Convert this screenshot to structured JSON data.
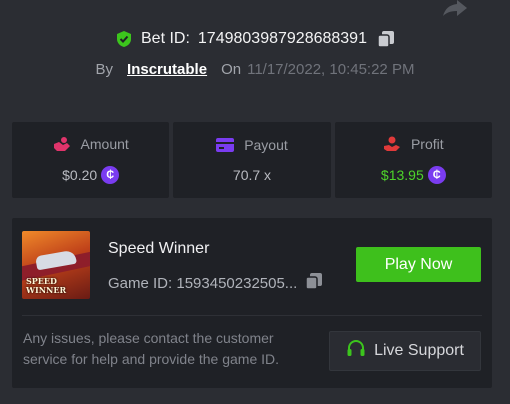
{
  "bet": {
    "label": "Bet ID:",
    "id": "1749803987928688391",
    "by_label": "By",
    "user": "Inscrutable",
    "on_label": "On",
    "datetime": "11/17/2022, 10:45:22 PM"
  },
  "stats": {
    "amount": {
      "label": "Amount",
      "value": "$0.20"
    },
    "payout": {
      "label": "Payout",
      "value": "70.7 x"
    },
    "profit": {
      "label": "Profit",
      "value": "$13.95"
    }
  },
  "game": {
    "title": "Speed Winner",
    "id_label": "Game ID:",
    "id_value": "1593450232505...",
    "thumb_text_line1": "SPEED",
    "thumb_text_line2": "WINNER",
    "play_label": "Play Now"
  },
  "support": {
    "message": "Any issues, please contact the customer service for help and provide the game ID.",
    "button_label": "Live Support"
  },
  "colors": {
    "background": "#2b2d33",
    "card": "#1f2126",
    "accent_green": "#3ec01c",
    "profit_green": "#4dd42a",
    "coin_purple": "#7a3cf0"
  },
  "icons": {
    "share": "share-icon",
    "verified": "shield-check-icon",
    "copy": "copy-icon",
    "amount": "hand-coin-icon",
    "payout": "card-icon",
    "profit": "profit-hand-icon",
    "currency": "coin-icon",
    "support": "headset-icon"
  }
}
